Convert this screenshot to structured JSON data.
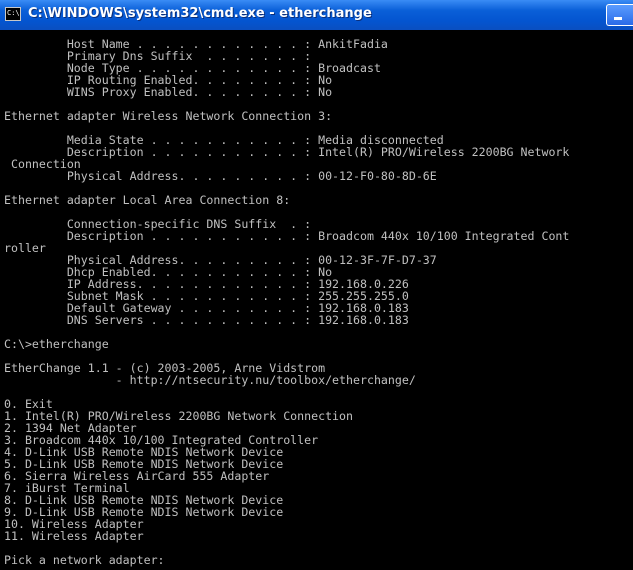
{
  "window": {
    "title": "C:\\WINDOWS\\system32\\cmd.exe - etherchange",
    "icon_label": "C:\\"
  },
  "console": {
    "lines": [
      "         Host Name . . . . . . . . . . . . : AnkitFadia",
      "         Primary Dns Suffix  . . . . . . . :",
      "         Node Type . . . . . . . . . . . . : Broadcast",
      "         IP Routing Enabled. . . . . . . . : No",
      "         WINS Proxy Enabled. . . . . . . . : No",
      "",
      "Ethernet adapter Wireless Network Connection 3:",
      "",
      "         Media State . . . . . . . . . . . : Media disconnected",
      "         Description . . . . . . . . . . . : Intel(R) PRO/Wireless 2200BG Network",
      " Connection",
      "         Physical Address. . . . . . . . . : 00-12-F0-80-8D-6E",
      "",
      "Ethernet adapter Local Area Connection 8:",
      "",
      "         Connection-specific DNS Suffix  . :",
      "         Description . . . . . . . . . . . : Broadcom 440x 10/100 Integrated Cont",
      "roller",
      "         Physical Address. . . . . . . . . : 00-12-3F-7F-D7-37",
      "         Dhcp Enabled. . . . . . . . . . . : No",
      "         IP Address. . . . . . . . . . . . : 192.168.0.226",
      "         Subnet Mask . . . . . . . . . . . : 255.255.255.0",
      "         Default Gateway . . . . . . . . . : 192.168.0.183",
      "         DNS Servers . . . . . . . . . . . : 192.168.0.183",
      "",
      "C:\\>etherchange",
      "",
      "EtherChange 1.1 - (c) 2003-2005, Arne Vidstrom",
      "                - http://ntsecurity.nu/toolbox/etherchange/",
      "",
      "0. Exit",
      "1. Intel(R) PRO/Wireless 2200BG Network Connection",
      "2. 1394 Net Adapter",
      "3. Broadcom 440x 10/100 Integrated Controller",
      "4. D-Link USB Remote NDIS Network Device",
      "5. D-Link USB Remote NDIS Network Device",
      "6. Sierra Wireless AirCard 555 Adapter",
      "7. iBurst Terminal",
      "8. D-Link USB Remote NDIS Network Device",
      "9. D-Link USB Remote NDIS Network Device",
      "10. Wireless Adapter",
      "11. Wireless Adapter",
      "",
      "Pick a network adapter:"
    ]
  }
}
